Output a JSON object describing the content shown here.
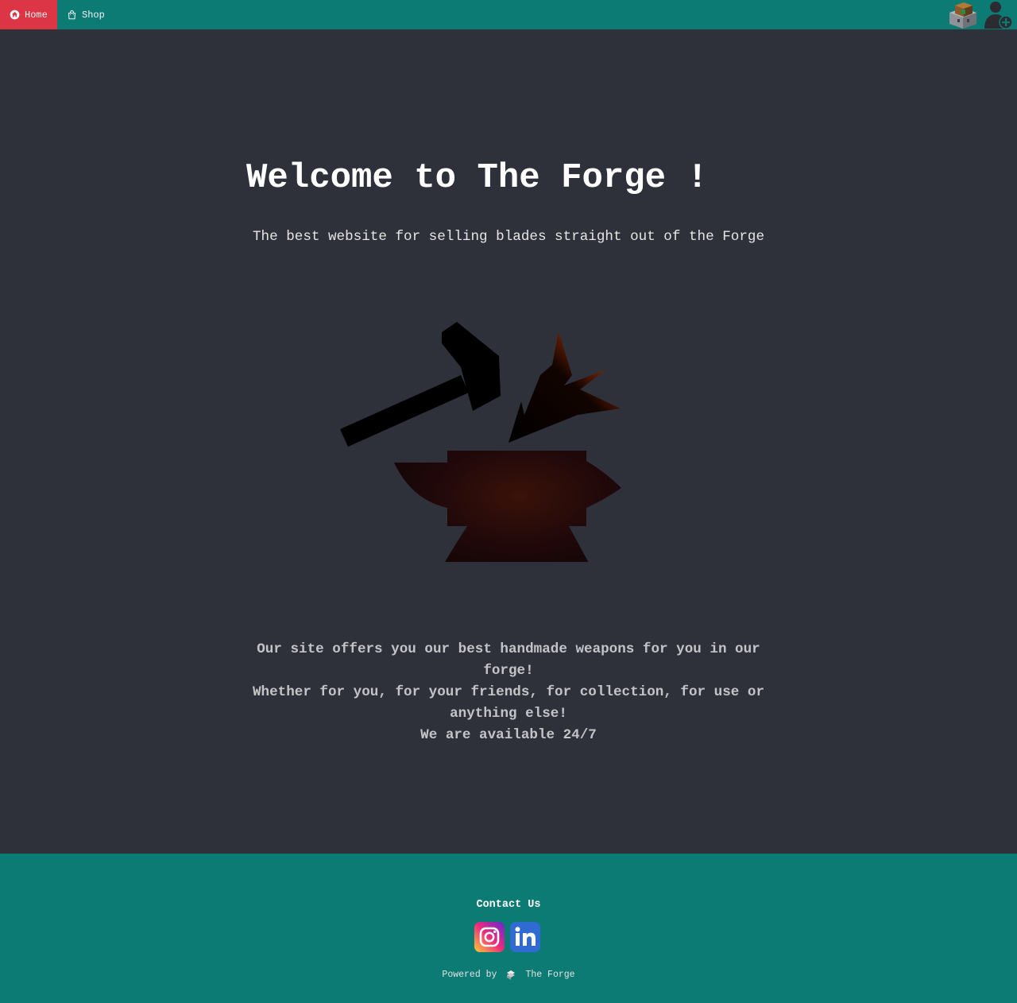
{
  "nav": {
    "home_label": "Home",
    "shop_label": "Shop",
    "active": "Home",
    "active_color": "#dc3545"
  },
  "icons": {
    "home": "home-icon",
    "shop": "shopping-bag-icon",
    "cart": "cart-icon",
    "user_add": "user-add-icon",
    "hero": "anvil-hammer-icon",
    "instagram": "instagram-icon",
    "linkedin": "linkedin-icon",
    "forge_logo": "forge-logo-icon"
  },
  "hero": {
    "title": "Welcome to The Forge !",
    "subtitle": "The best website for selling blades straight out of the Forge"
  },
  "description": {
    "line1": "Our site offers you our best handmade weapons for you in our forge!",
    "line2": "Whether for you, for your friends, for collection, for use or anything else!",
    "line3": "We are available 24/7"
  },
  "footer": {
    "contact_title": "Contact Us",
    "powered_by": "Powered by",
    "brand": "The Forge"
  },
  "colors": {
    "topbar": "#0b7b74",
    "background": "#2f313a",
    "footer": "#0b7b74"
  }
}
